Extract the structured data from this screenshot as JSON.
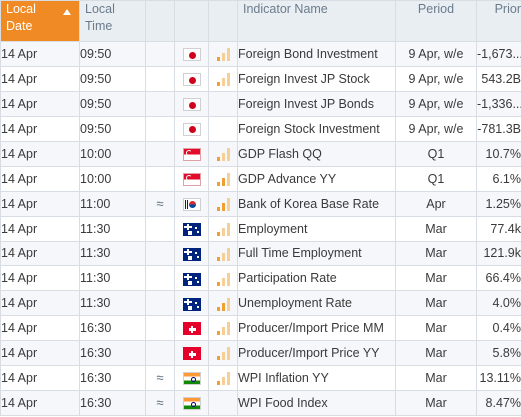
{
  "headers": {
    "date": [
      "Local",
      "Date"
    ],
    "time": [
      "Local",
      "Time"
    ],
    "indicator": "Indicator Name",
    "period": "Period",
    "prior": "Prior"
  },
  "colors": {
    "sorted_header": "#f08a24",
    "bar_active": "#f0a030",
    "bar_inactive": "#f5cf95"
  },
  "rows": [
    {
      "date": "14 Apr",
      "time": "09:50",
      "volatile": "",
      "flag": "japan-flag-icon",
      "importance": "low",
      "name": "Foreign Bond Investment",
      "period": "9 Apr, w/e",
      "prior": "-1,673...."
    },
    {
      "date": "14 Apr",
      "time": "09:50",
      "volatile": "",
      "flag": "japan-flag-icon",
      "importance": "low",
      "name": "Foreign Invest JP Stock",
      "period": "9 Apr, w/e",
      "prior": "543.2B"
    },
    {
      "date": "14 Apr",
      "time": "09:50",
      "volatile": "",
      "flag": "japan-flag-icon",
      "importance": "none",
      "name": "Foreign Invest JP Bonds",
      "period": "9 Apr, w/e",
      "prior": "-1,336...."
    },
    {
      "date": "14 Apr",
      "time": "09:50",
      "volatile": "",
      "flag": "japan-flag-icon",
      "importance": "none",
      "name": "Foreign Stock Investment",
      "period": "9 Apr, w/e",
      "prior": "-781.3B"
    },
    {
      "date": "14 Apr",
      "time": "10:00",
      "volatile": "",
      "flag": "singapore-flag-icon",
      "importance": "low",
      "name": "GDP Flash QQ",
      "period": "Q1",
      "prior": "10.7%"
    },
    {
      "date": "14 Apr",
      "time": "10:00",
      "volatile": "",
      "flag": "singapore-flag-icon",
      "importance": "medium",
      "name": "GDP Advance YY",
      "period": "Q1",
      "prior": "6.1%"
    },
    {
      "date": "14 Apr",
      "time": "11:00",
      "volatile": "≈",
      "flag": "south-korea-flag-icon",
      "importance": "medium",
      "name": "Bank of Korea Base Rate",
      "period": "Apr",
      "prior": "1.25%"
    },
    {
      "date": "14 Apr",
      "time": "11:30",
      "volatile": "",
      "flag": "australia-flag-icon",
      "importance": "low",
      "name": "Employment",
      "period": "Mar",
      "prior": "77.4k"
    },
    {
      "date": "14 Apr",
      "time": "11:30",
      "volatile": "",
      "flag": "australia-flag-icon",
      "importance": "low",
      "name": "Full Time Employment",
      "period": "Mar",
      "prior": "121.9k"
    },
    {
      "date": "14 Apr",
      "time": "11:30",
      "volatile": "",
      "flag": "australia-flag-icon",
      "importance": "low",
      "name": "Participation Rate",
      "period": "Mar",
      "prior": "66.4%"
    },
    {
      "date": "14 Apr",
      "time": "11:30",
      "volatile": "",
      "flag": "australia-flag-icon",
      "importance": "medium",
      "name": "Unemployment Rate",
      "period": "Mar",
      "prior": "4.0%"
    },
    {
      "date": "14 Apr",
      "time": "16:30",
      "volatile": "",
      "flag": "switzerland-flag-icon",
      "importance": "low",
      "name": "Producer/Import Price MM",
      "period": "Mar",
      "prior": "0.4%"
    },
    {
      "date": "14 Apr",
      "time": "16:30",
      "volatile": "",
      "flag": "switzerland-flag-icon",
      "importance": "low",
      "name": "Producer/Import Price YY",
      "period": "Mar",
      "prior": "5.8%"
    },
    {
      "date": "14 Apr",
      "time": "16:30",
      "volatile": "≈",
      "flag": "india-flag-icon",
      "importance": "low",
      "name": "WPI Inflation YY",
      "period": "Mar",
      "prior": "13.11%"
    },
    {
      "date": "14 Apr",
      "time": "16:30",
      "volatile": "≈",
      "flag": "india-flag-icon",
      "importance": "none",
      "name": "WPI Food Index",
      "period": "Mar",
      "prior": "8.47%"
    }
  ]
}
